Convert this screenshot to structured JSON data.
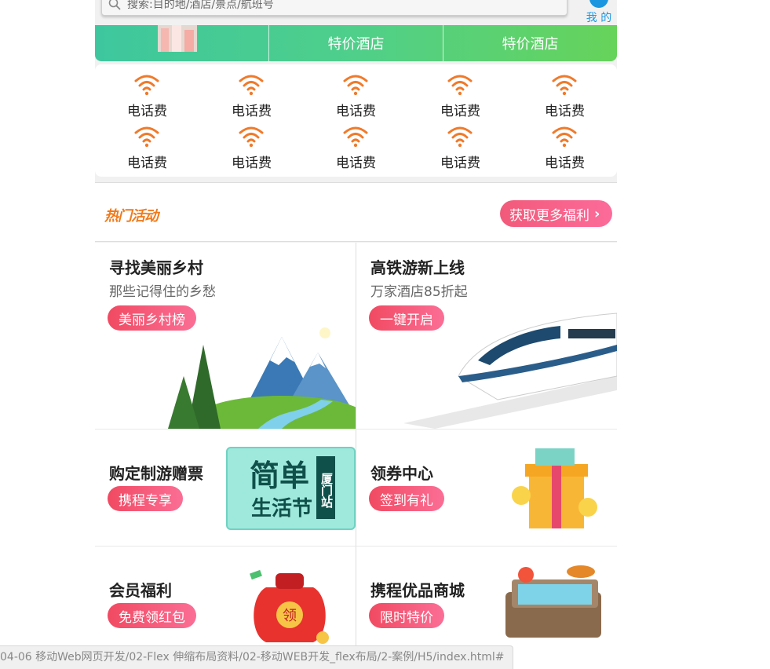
{
  "header": {
    "search_placeholder": "搜索:目的地/酒店/景点/航班号",
    "mine_label": "我 的"
  },
  "banner": {
    "items": [
      "",
      "特价酒店",
      "特价酒店"
    ]
  },
  "grid": {
    "items": [
      {
        "label": "电话费",
        "icon": "wifi-icon"
      },
      {
        "label": "电话费",
        "icon": "wifi-icon"
      },
      {
        "label": "电话费",
        "icon": "wifi-icon"
      },
      {
        "label": "电话费",
        "icon": "wifi-icon"
      },
      {
        "label": "电话费",
        "icon": "wifi-icon"
      },
      {
        "label": "电话费",
        "icon": "wifi-icon"
      },
      {
        "label": "电话费",
        "icon": "wifi-icon"
      },
      {
        "label": "电话费",
        "icon": "wifi-icon"
      },
      {
        "label": "电话费",
        "icon": "wifi-icon"
      },
      {
        "label": "电话费",
        "icon": "wifi-icon"
      }
    ],
    "icon_color": "#f07a2a"
  },
  "hot": {
    "title": "热门活动",
    "more_label": "获取更多福利"
  },
  "cards": [
    {
      "title": "寻找美丽乡村",
      "subtitle": "那些记得住的乡愁",
      "button": "美丽乡村榜"
    },
    {
      "title": "高铁游新上线",
      "subtitle": "万家酒店85折起",
      "button": "一键开启"
    },
    {
      "title": "购定制游赠票",
      "button": "携程专享",
      "ticket_big": "简单",
      "ticket_mid": "生活节",
      "ticket_side": "厦门站"
    },
    {
      "title": "领券中心",
      "button": "签到有礼"
    },
    {
      "title": "会员福利",
      "button": "免费领红包",
      "bag_label": "领"
    },
    {
      "title": "携程优品商城",
      "button": "限时特价"
    }
  ],
  "status_url": "04-06 移动Web网页开发/02-Flex 伸缩布局资料/02-移动WEB开发_flex布局/2-案例/H5/index.html#",
  "colors": {
    "accent": "#f14a62",
    "hot": "#f07a1a",
    "link": "#1a96e0"
  }
}
